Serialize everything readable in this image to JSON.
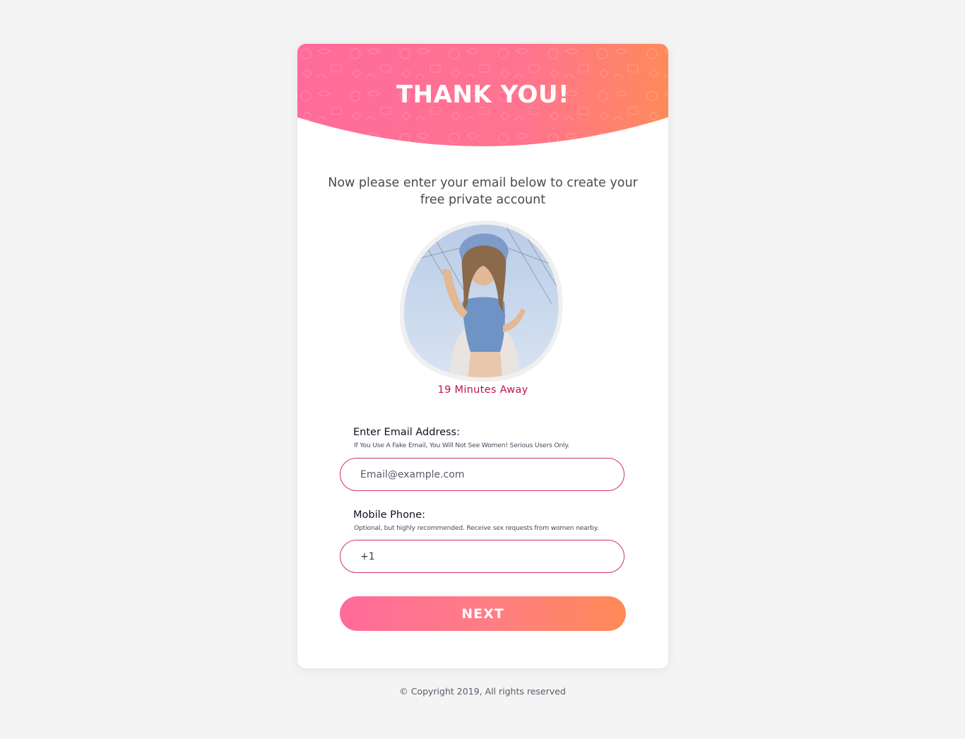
{
  "header": {
    "title": "THANK YOU!",
    "gradient_start": "#ff6b9a",
    "gradient_end": "#ff8a55"
  },
  "subtitle": "Now please enter your email below to create your free private account",
  "profile": {
    "photo": "profile-photo",
    "distance": "19 Minutes Away"
  },
  "email": {
    "label": "Enter Email Address:",
    "hint": "If You Use A Fake Email, You Will Not See Women! Serious Users Only.",
    "placeholder": "Email@example.com",
    "value": ""
  },
  "phone": {
    "label": "Mobile Phone:",
    "hint": "Optional, but highly recommended. Receive sex requests from women nearby.",
    "value": "+1"
  },
  "next_button": {
    "label": "NEXT"
  },
  "footer": {
    "copyright": "© Copyright 2019, All rights reserved"
  },
  "colors": {
    "accent": "#c1134a",
    "field_border": "#d0336e",
    "page_background": "#f4f4f4"
  }
}
